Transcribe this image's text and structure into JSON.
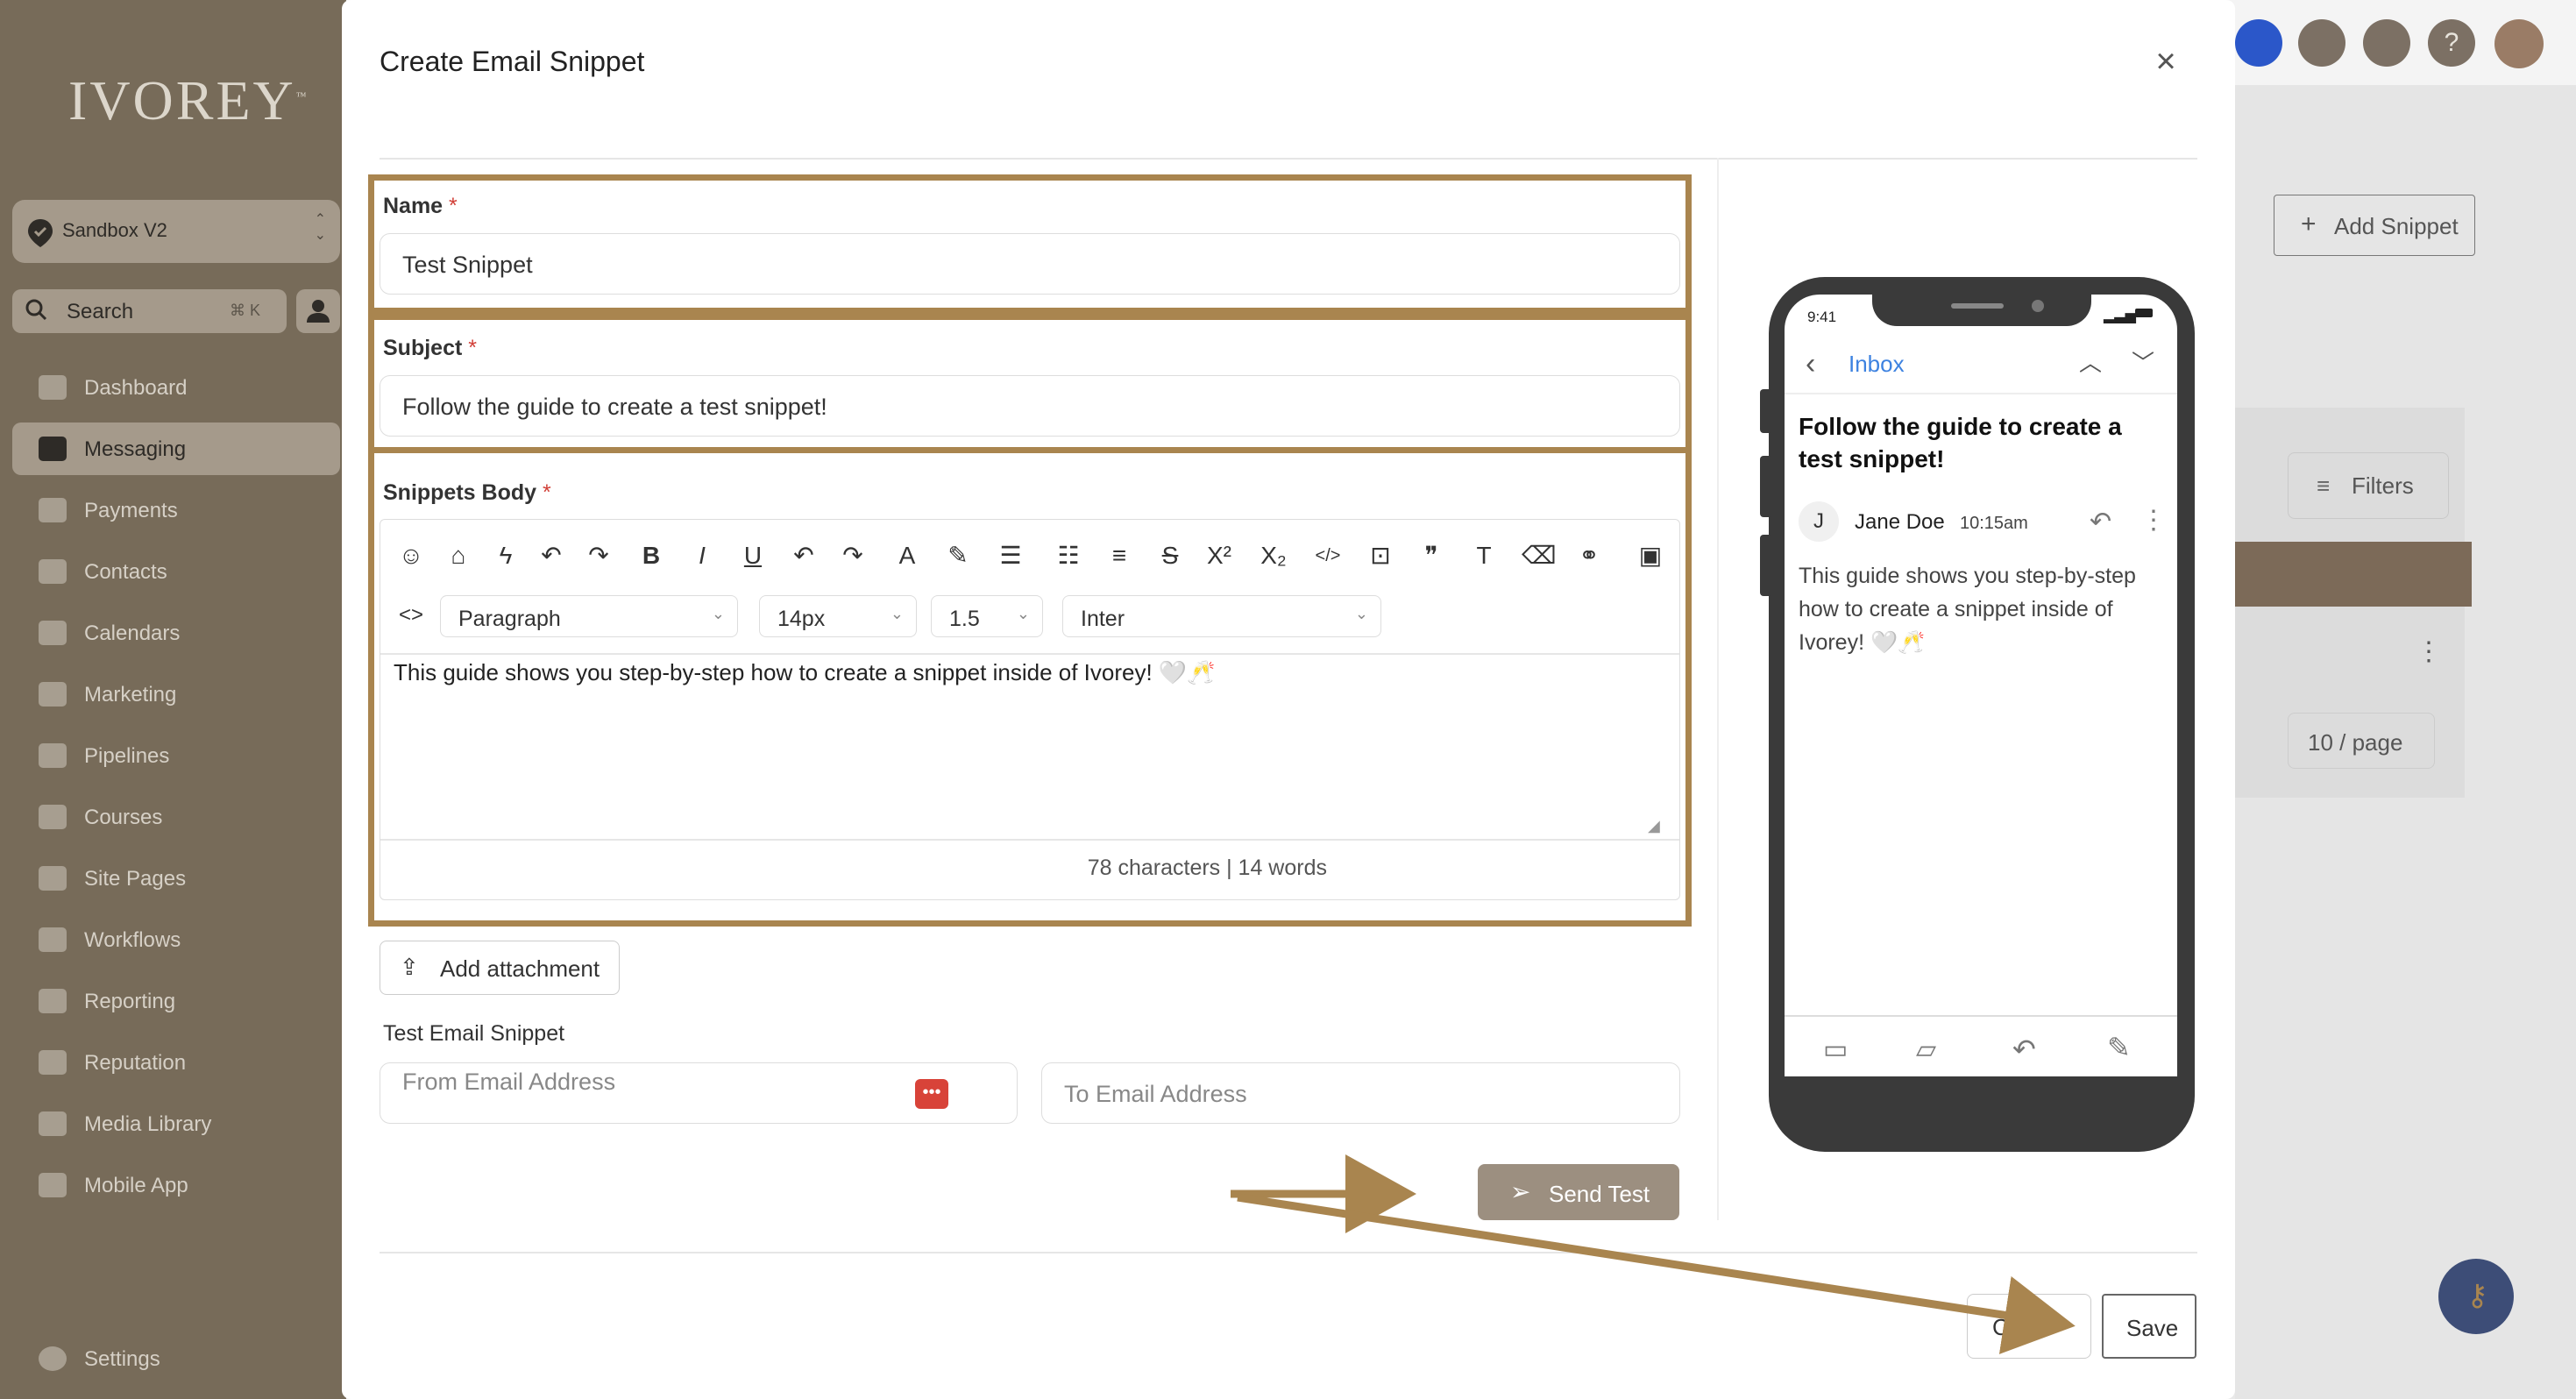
{
  "sidebar": {
    "logo": "IVOREY",
    "workspace": "Sandbox V2",
    "search": {
      "label": "Search",
      "shortcut": "⌘ K"
    },
    "items": [
      {
        "label": "Dashboard",
        "active": false
      },
      {
        "label": "Messaging",
        "active": true
      },
      {
        "label": "Payments",
        "active": false
      },
      {
        "label": "Contacts",
        "active": false
      },
      {
        "label": "Calendars",
        "active": false
      },
      {
        "label": "Marketing",
        "active": false
      },
      {
        "label": "Pipelines",
        "active": false
      },
      {
        "label": "Courses",
        "active": false
      },
      {
        "label": "Site Pages",
        "active": false
      },
      {
        "label": "Workflows",
        "active": false
      },
      {
        "label": "Reporting",
        "active": false
      },
      {
        "label": "Reputation",
        "active": false
      },
      {
        "label": "Media Library",
        "active": false
      },
      {
        "label": "Mobile App",
        "active": false
      }
    ],
    "settings": "Settings"
  },
  "background": {
    "add_snippet": "Add Snippet",
    "filters": "Filters",
    "per_page": "10 / page"
  },
  "modal": {
    "title": "Create Email Snippet",
    "name": {
      "label": "Name",
      "value": "Test Snippet"
    },
    "subject": {
      "label": "Subject",
      "value": "Follow the guide to create a test snippet!"
    },
    "body": {
      "label": "Snippets Body",
      "paragraph": "Paragraph",
      "font_size": "14px",
      "line_height": "1.5",
      "font": "Inter",
      "text": "This guide shows you step-by-step how to create a snippet inside of Ivorey! 🤍🥂",
      "counter": "78 characters | 14 words"
    },
    "add_attachment": "Add attachment",
    "test_section": "Test Email Snippet",
    "from_placeholder": "From Email Address",
    "to_placeholder": "To Email Address",
    "send_test": "Send Test",
    "cancel": "Can",
    "save": "Save"
  },
  "preview": {
    "time": "9:41",
    "inbox": "Inbox",
    "subject": "Follow the guide to create a test snippet!",
    "avatar": "J",
    "sender": "Jane Doe",
    "sent_time": "10:15am",
    "body": "This guide shows you step-by-step how to create a snippet inside of Ivorey! 🤍🥂"
  },
  "colors": {
    "brand": "#a9854f",
    "sidebar": "#776b59",
    "send_button": "#9c8f80"
  }
}
